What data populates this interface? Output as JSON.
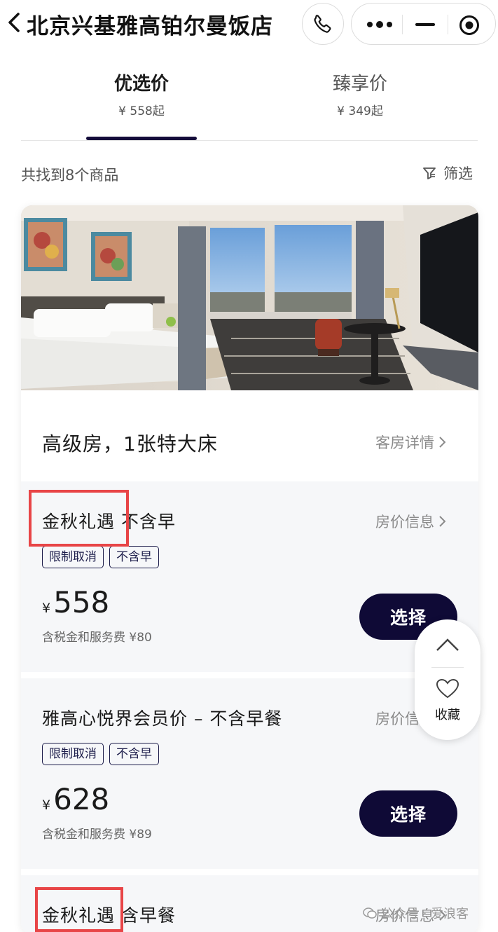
{
  "header": {
    "title": "北京兴基雅高铂尔曼饭店"
  },
  "tabs": [
    {
      "label": "优选价",
      "price": "¥ 558起",
      "active": true
    },
    {
      "label": "臻享价",
      "price": "¥ 349起",
      "active": false
    }
  ],
  "result_count": "共找到8个商品",
  "filter_label": "筛选",
  "room": {
    "name": "高级房，1张特大床",
    "detail_link": "客房详情"
  },
  "rates": [
    {
      "title": "金秋礼遇 不含早",
      "info_link": "房价信息",
      "tags": [
        "限制取消",
        "不含早"
      ],
      "currency": "¥",
      "price": "558",
      "tax": "含税金和服务费 ¥80",
      "button": "选择"
    },
    {
      "title": "雅高心悦界会员价 – 不含早餐",
      "info_link": "房价信息",
      "tags": [
        "限制取消",
        "不含早"
      ],
      "currency": "¥",
      "price": "628",
      "tax": "含税金和服务费 ¥89",
      "button": "选择"
    },
    {
      "title": "金秋礼遇 含早餐",
      "info_link": "房价信息"
    }
  ],
  "float_widget": {
    "favorite_label": "收藏"
  },
  "watermark": "公众号 · 爱浪客",
  "colors": {
    "primary": "#0f0a36",
    "highlight_box": "#e84547",
    "rate_bg": "#f6f7f9"
  }
}
